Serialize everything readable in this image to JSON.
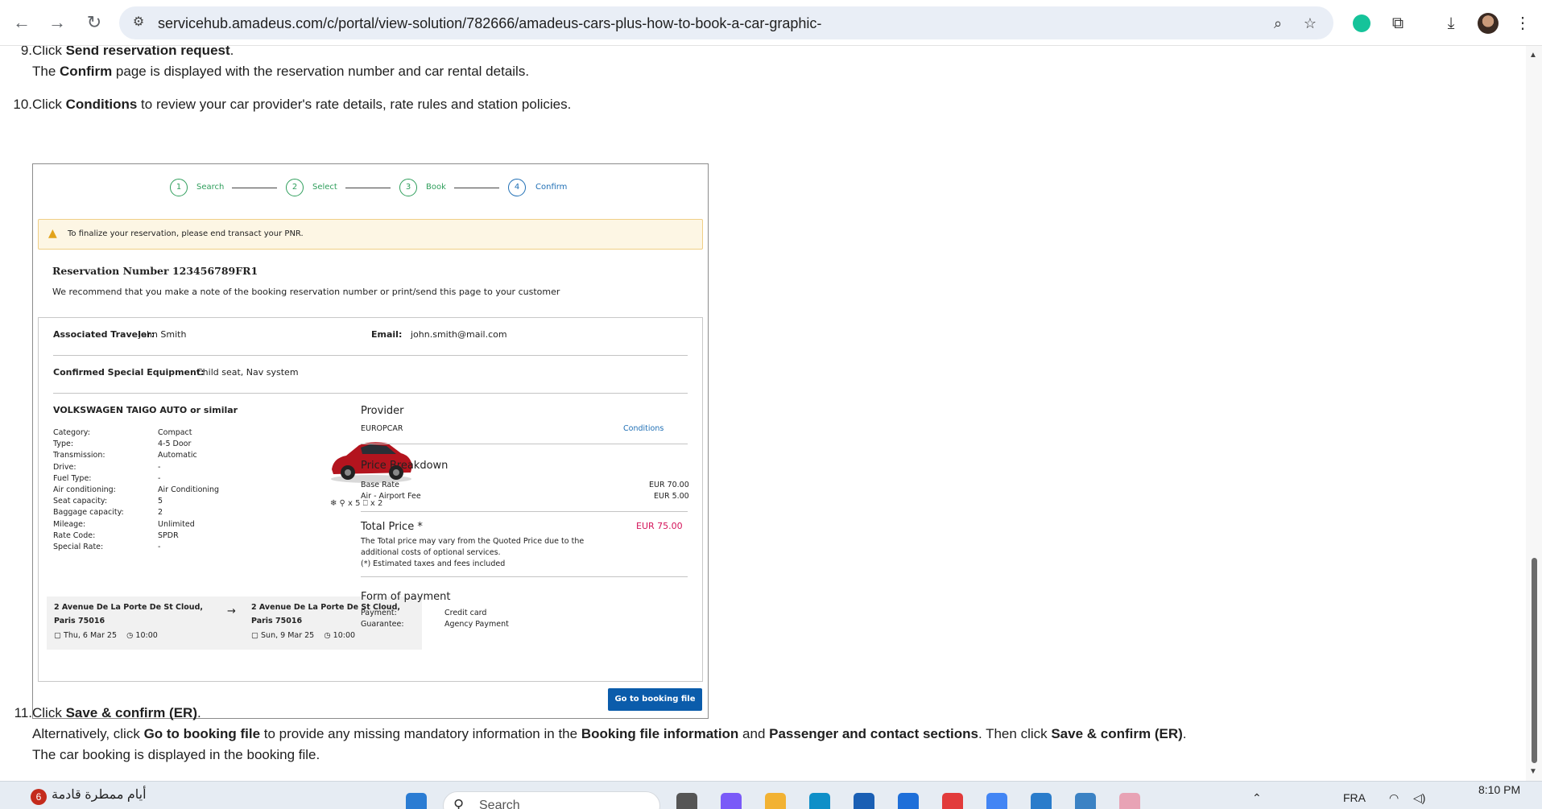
{
  "browser": {
    "url": "servicehub.amadeus.com/c/portal/view-solution/782666/amadeus-cars-plus-how-to-book-a-car-graphic-"
  },
  "steps": {
    "s9": {
      "num": "9.",
      "pre": "Click ",
      "bold": "Send reservation request",
      "post": ".",
      "sub_pre": "The ",
      "sub_bold": "Confirm",
      "sub_post": " page is displayed with the reservation number and car rental details."
    },
    "s10": {
      "num": "10.",
      "pre": "Click ",
      "bold": "Conditions",
      "post": " to review your car provider's rate details, rate rules and station policies."
    },
    "s11": {
      "num": "11.",
      "pre": "Click ",
      "bold": "Save & confirm (ER)",
      "post": ".",
      "alt_1": "Alternatively, click ",
      "alt_b1": "Go to booking file",
      "alt_2": " to provide any missing mandatory information in the ",
      "alt_b2": "Booking file information",
      "alt_3": " and ",
      "alt_b3": "Passenger and contact sections",
      "alt_4": ". Then click ",
      "alt_b4": "Save & confirm (ER)",
      "alt_5": ".",
      "last": "The car booking is displayed in the booking file."
    }
  },
  "graphic": {
    "stepper": [
      {
        "n": "1",
        "label": "Search"
      },
      {
        "n": "2",
        "label": "Select"
      },
      {
        "n": "3",
        "label": "Book"
      },
      {
        "n": "4",
        "label": "Confirm"
      }
    ],
    "alert": "To finalize your reservation, please end transact your PNR.",
    "reservation_number": "Reservation Number 123456789FR1",
    "recommend": "We recommend that you make a note of the booking reservation number or print/send this page to your customer",
    "traveler_label": "Associated Traveler:",
    "traveler": "John Smith",
    "email_label": "Email:",
    "email": "john.smith@mail.com",
    "equipment_label": "Confirmed Special Equipment:",
    "equipment": "Child seat, Nav system",
    "car_name": "VOLKSWAGEN TAIGO AUTO or similar",
    "specs": [
      {
        "k": "Category:",
        "v": "Compact"
      },
      {
        "k": "Type:",
        "v": "4-5 Door"
      },
      {
        "k": "Transmission:",
        "v": "Automatic"
      },
      {
        "k": "Drive:",
        "v": "-"
      },
      {
        "k": "Fuel Type:",
        "v": "-"
      },
      {
        "k": "Air conditioning:",
        "v": "Air Conditioning"
      },
      {
        "k": "Seat capacity:",
        "v": "5"
      },
      {
        "k": "Baggage capacity:",
        "v": "2"
      },
      {
        "k": "Mileage:",
        "v": "Unlimited"
      },
      {
        "k": "Rate Code:",
        "v": "SPDR"
      },
      {
        "k": "Special Rate:",
        "v": "-"
      }
    ],
    "car_features": "❄  ⚲ x 5  ⎕ x 2",
    "pickup_address": "2 Avenue De La Porte De St Cloud, Paris 75016",
    "pickup_date": "Thu, 6 Mar 25",
    "pickup_time": "10:00",
    "return_address": "2 Avenue De La Porte De St Cloud, Paris 75016",
    "return_date": "Sun, 9 Mar 25",
    "return_time": "10:00",
    "provider_title": "Provider",
    "provider": "EUROPCAR",
    "conditions_link": "Conditions",
    "price_title": "Price Breakdown",
    "base_rate_label": "Base Rate",
    "base_rate": "EUR 70.00",
    "fee_label": "Air - Airport Fee",
    "fee": "EUR 5.00",
    "total_label": "Total Price *",
    "total": "EUR 75.00",
    "total_note_1": "The Total price may vary from the Quoted Price due to the",
    "total_note_2": "additional costs of optional services.",
    "total_note_3": "(*) Estimated taxes and fees included",
    "payment_title": "Form of payment",
    "payment_label": "Payment:",
    "payment": "Credit card",
    "guarantee_label": "Guarantee:",
    "guarantee": "Agency Payment",
    "goto_button": "Go to booking file"
  },
  "taskbar": {
    "weather": "أيام ممطرة قادمة",
    "weather_badge": "6",
    "search_placeholder": "Search",
    "language": "FRA",
    "time": "8:10 PM"
  },
  "colors": {
    "accent": "#1f6fb5",
    "step_done": "#2e9e5b",
    "total_price": "#d4145a",
    "button": "#0b5cab",
    "alert_bg": "#fdf6e4"
  }
}
